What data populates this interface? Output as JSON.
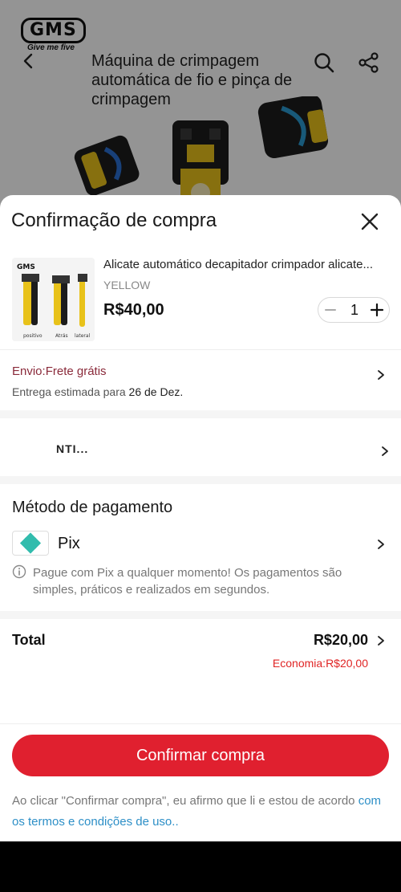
{
  "background_page": {
    "logo_text": "GMS",
    "logo_tagline": "Give me five",
    "product_title": "Máquina de crimpagem automática de fio e pinça de crimpagem"
  },
  "sheet": {
    "title": "Confirmação de compra"
  },
  "product": {
    "name": "Alicate automático decapitador crimpador alicate...",
    "variant": "YELLOW",
    "price": "R$40,00",
    "quantity": "1",
    "thumb_logo": "GMS",
    "thumb_labels": [
      "positivo",
      "Atrás",
      "lateral"
    ]
  },
  "shipping": {
    "label": "Envio:Frete grátis",
    "estimate_prefix": "Entrega estimada para",
    "estimate_date": "26 de Dez."
  },
  "address": {
    "text": "NTI..."
  },
  "payment": {
    "title": "Método de pagamento",
    "method": "Pix",
    "info": "Pague com Pix a qualquer momento! Os pagamentos são simples, práticos e realizados em segundos."
  },
  "summary": {
    "total_label": "Total",
    "total_value": "R$20,00",
    "savings": "Economia:R$20,00"
  },
  "confirm_button": "Confirmar compra",
  "terms": {
    "text": "Ao clicar \"Confirmar compra\", eu afirmo que li e estou de acordo",
    "link": "com os termos e condições de uso.."
  },
  "colors": {
    "accent": "#e0202f",
    "pix": "#32bcad",
    "link": "#2d8fc7",
    "savings": "#e02424"
  }
}
